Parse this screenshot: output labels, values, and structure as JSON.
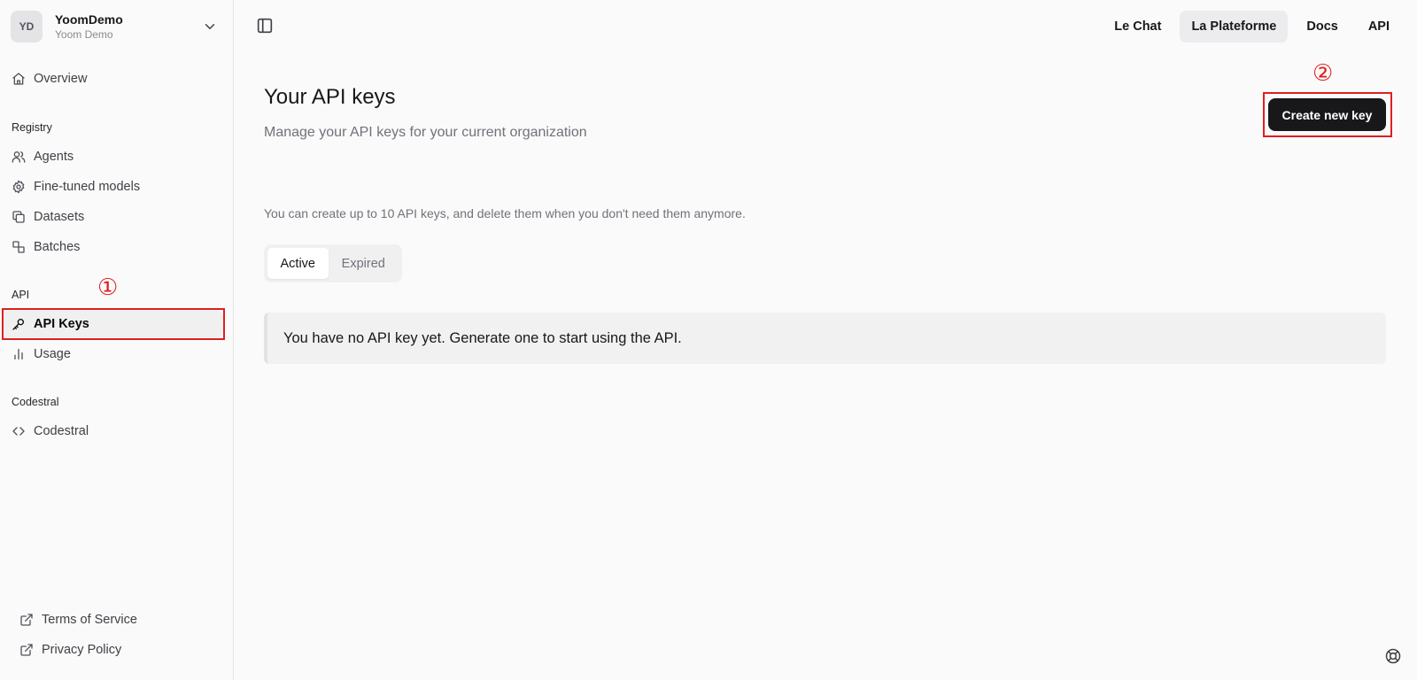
{
  "org": {
    "initials": "YD",
    "name": "YoomDemo",
    "subtitle": "Yoom Demo"
  },
  "sidebar": {
    "overview": "Overview",
    "registry_label": "Registry",
    "registry_items": [
      {
        "label": "Agents",
        "icon": "users-icon"
      },
      {
        "label": "Fine-tuned models",
        "icon": "gear-icon"
      },
      {
        "label": "Datasets",
        "icon": "copy-icon"
      },
      {
        "label": "Batches",
        "icon": "shapes-icon"
      }
    ],
    "api_label": "API",
    "api_items": [
      {
        "label": "API Keys",
        "icon": "key-icon",
        "active": true
      },
      {
        "label": "Usage",
        "icon": "bar-chart-icon"
      }
    ],
    "codestral_label": "Codestral",
    "codestral_items": [
      {
        "label": "Codestral",
        "icon": "code-icon"
      }
    ],
    "footer_links": [
      {
        "label": "Terms of Service",
        "icon": "external-link-icon"
      },
      {
        "label": "Privacy Policy",
        "icon": "external-link-icon"
      }
    ]
  },
  "topnav": {
    "items": [
      {
        "label": "Le Chat"
      },
      {
        "label": "La Plateforme",
        "selected": true
      },
      {
        "label": "Docs"
      },
      {
        "label": "API"
      }
    ]
  },
  "main": {
    "title": "Your API keys",
    "subtitle": "Manage your API keys for your current organization",
    "create_button": "Create new key",
    "info_text": "You can create up to 10 API keys, and delete them when you don't need them anymore.",
    "tabs": [
      {
        "label": "Active",
        "selected": true
      },
      {
        "label": "Expired"
      }
    ],
    "empty_message": "You have no API key yet. Generate one to start using the API."
  },
  "annotations": {
    "step1": "①",
    "step2": "②",
    "color": "#e01e1e"
  }
}
